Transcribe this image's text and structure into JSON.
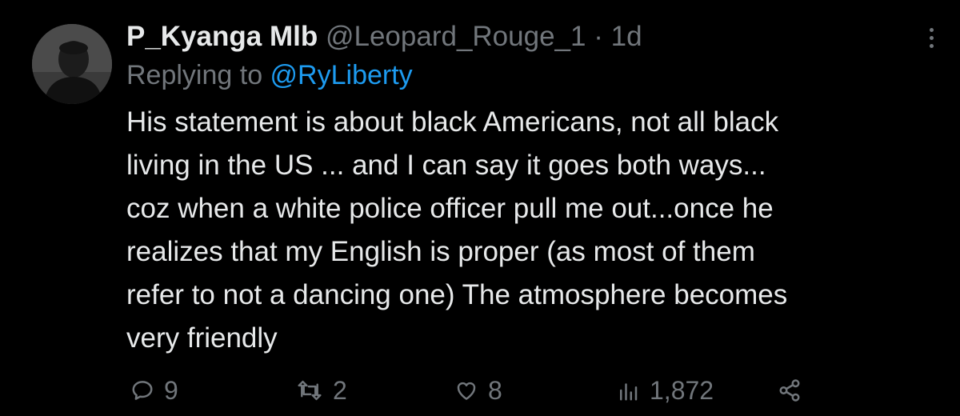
{
  "tweet": {
    "author_name": "P_Kyanga Mlb",
    "author_handle": "@Leopard_Rouge_1",
    "separator": "·",
    "time": "1d",
    "reply_prefix": "Replying to ",
    "reply_handle": "@RyLiberty",
    "body_lines": [
      "His statement is about black Americans, not all black",
      "living in the US ... and I can say it goes both ways...",
      "coz when a white police officer pull me out...once he",
      "realizes that my English is proper (as most of them",
      "refer to not a dancing one) The atmosphere becomes",
      "very friendly"
    ]
  },
  "actions": {
    "replies": "9",
    "retweets": "2",
    "likes": "8",
    "views": "1,872"
  },
  "icons": [
    "avatar",
    "more-icon",
    "reply-icon",
    "retweet-icon",
    "like-icon",
    "views-icon",
    "share-icon"
  ],
  "colors": {
    "background": "#000000",
    "text": "#e7e9ea",
    "muted": "#71767b",
    "link": "#1d9bf0"
  }
}
